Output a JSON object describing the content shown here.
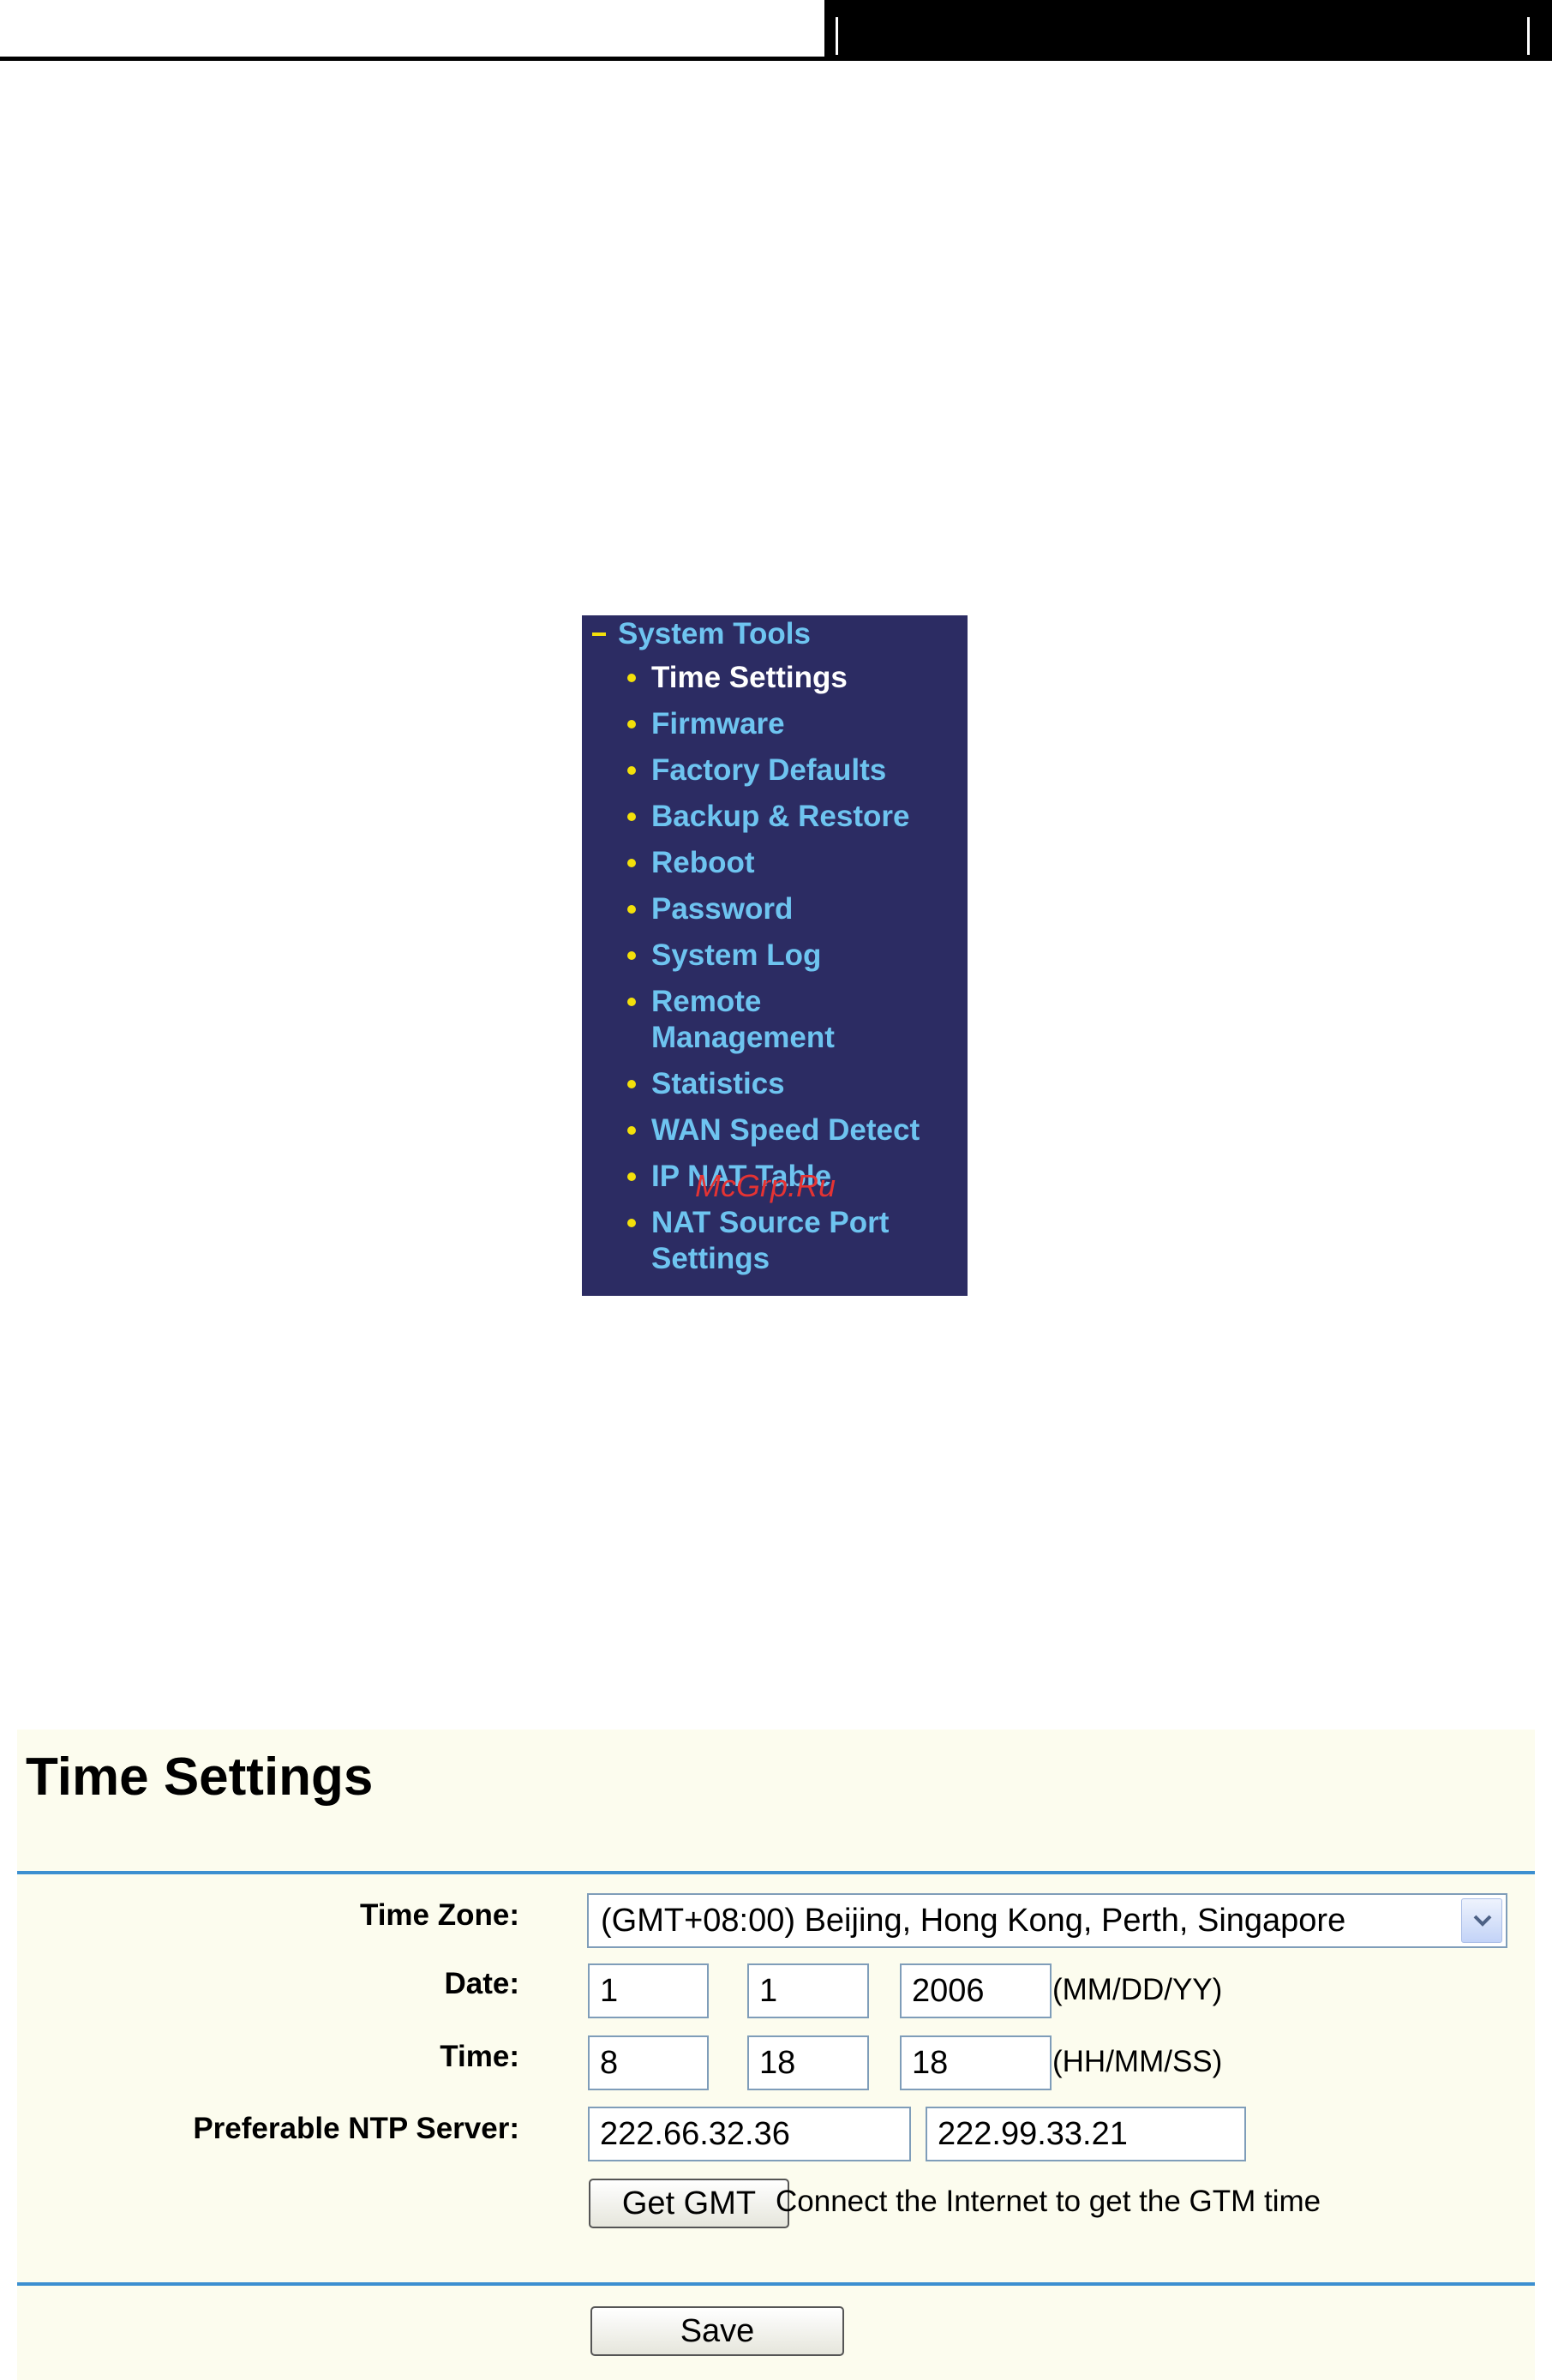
{
  "menu": {
    "title": "System Tools",
    "items": [
      {
        "label": "Time Settings",
        "active": true
      },
      {
        "label": "Firmware"
      },
      {
        "label": "Factory Defaults"
      },
      {
        "label": "Backup & Restore"
      },
      {
        "label": "Reboot"
      },
      {
        "label": "Password"
      },
      {
        "label": "System Log"
      },
      {
        "label": "Remote",
        "label2": "Management"
      },
      {
        "label": "Statistics"
      },
      {
        "label": "WAN Speed Detect"
      },
      {
        "label": "IP NAT Table"
      },
      {
        "label": "NAT Source Port",
        "label2": "Settings"
      }
    ]
  },
  "watermark": "McGrp.Ru",
  "colors": {
    "menu_bg": "#2c2c63",
    "menu_link": "#6ec4f0",
    "menu_bullet": "#f3e00a",
    "panel_bg": "#fcfcee",
    "rule": "#3c8fd0"
  },
  "time_settings": {
    "title": "Time Settings",
    "time_zone": {
      "label": "Time Zone:",
      "value": "(GMT+08:00) Beijing, Hong Kong, Perth, Singapore"
    },
    "date": {
      "label": "Date:",
      "month": "1",
      "day": "1",
      "year": "2006",
      "format": "(MM/DD/YY)"
    },
    "time": {
      "label": "Time:",
      "hour": "8",
      "minute": "18",
      "second": "18",
      "format": "(HH/MM/SS)"
    },
    "ntp": {
      "label": "Preferable NTP Server:",
      "server1": "222.66.32.36",
      "server2": "222.99.33.21"
    },
    "get_gmt_label": "Get GMT",
    "get_gmt_note": "Connect the Internet to get the GTM time",
    "save_label": "Save"
  }
}
